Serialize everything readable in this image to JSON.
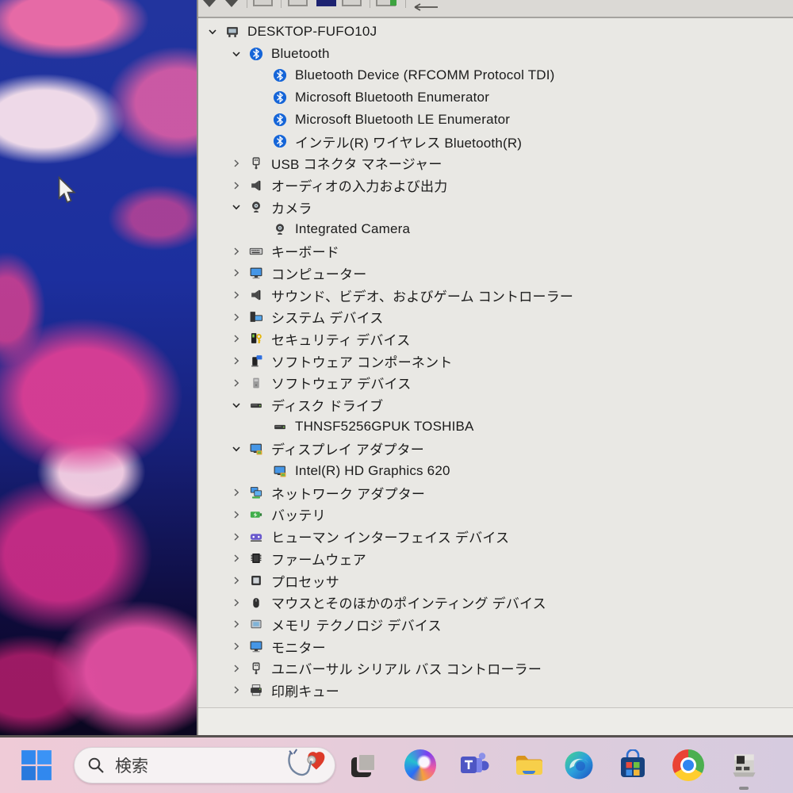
{
  "device_manager": {
    "toolbar_icons": [
      "partial-arrow-1",
      "partial-arrow-2",
      "partial-square-1",
      "partial-square-2",
      "partial-square-navy",
      "partial-square-3",
      "partial-square-green",
      "back-arrow"
    ],
    "tree": [
      {
        "label": "DESKTOP-FUFO10J",
        "icon": "computer",
        "level": 0,
        "state": "expanded"
      },
      {
        "label": "Bluetooth",
        "icon": "bluetooth",
        "level": 1,
        "state": "expanded"
      },
      {
        "label": "Bluetooth Device (RFCOMM Protocol TDI)",
        "icon": "bluetooth",
        "level": 2,
        "state": "leaf"
      },
      {
        "label": "Microsoft Bluetooth Enumerator",
        "icon": "bluetooth",
        "level": 2,
        "state": "leaf"
      },
      {
        "label": "Microsoft Bluetooth LE Enumerator",
        "icon": "bluetooth",
        "level": 2,
        "state": "leaf"
      },
      {
        "label": "インテル(R) ワイヤレス Bluetooth(R)",
        "icon": "bluetooth",
        "level": 2,
        "state": "leaf"
      },
      {
        "label": "USB コネクタ マネージャー",
        "icon": "usb",
        "level": 1,
        "state": "collapsed"
      },
      {
        "label": "オーディオの入力および出力",
        "icon": "audio",
        "level": 1,
        "state": "collapsed"
      },
      {
        "label": "カメラ",
        "icon": "camera",
        "level": 1,
        "state": "expanded"
      },
      {
        "label": "Integrated Camera",
        "icon": "camera",
        "level": 2,
        "state": "leaf"
      },
      {
        "label": "キーボード",
        "icon": "keyboard",
        "level": 1,
        "state": "collapsed"
      },
      {
        "label": "コンピューター",
        "icon": "monitor",
        "level": 1,
        "state": "collapsed"
      },
      {
        "label": "サウンド、ビデオ、およびゲーム コントローラー",
        "icon": "audio",
        "level": 1,
        "state": "collapsed"
      },
      {
        "label": "システム デバイス",
        "icon": "system",
        "level": 1,
        "state": "collapsed"
      },
      {
        "label": "セキュリティ デバイス",
        "icon": "security",
        "level": 1,
        "state": "collapsed"
      },
      {
        "label": "ソフトウェア コンポーネント",
        "icon": "software-component",
        "level": 1,
        "state": "collapsed"
      },
      {
        "label": "ソフトウェア デバイス",
        "icon": "software-device",
        "level": 1,
        "state": "collapsed"
      },
      {
        "label": "ディスク ドライブ",
        "icon": "disk",
        "level": 1,
        "state": "expanded"
      },
      {
        "label": "THNSF5256GPUK TOSHIBA",
        "icon": "disk",
        "level": 2,
        "state": "leaf"
      },
      {
        "label": "ディスプレイ アダプター",
        "icon": "display-adapter",
        "level": 1,
        "state": "expanded"
      },
      {
        "label": "Intel(R) HD Graphics 620",
        "icon": "display-adapter",
        "level": 2,
        "state": "leaf"
      },
      {
        "label": "ネットワーク アダプター",
        "icon": "network",
        "level": 1,
        "state": "collapsed"
      },
      {
        "label": "バッテリ",
        "icon": "battery",
        "level": 1,
        "state": "collapsed"
      },
      {
        "label": "ヒューマン インターフェイス デバイス",
        "icon": "hid",
        "level": 1,
        "state": "collapsed"
      },
      {
        "label": "ファームウェア",
        "icon": "firmware",
        "level": 1,
        "state": "collapsed"
      },
      {
        "label": "プロセッサ",
        "icon": "processor",
        "level": 1,
        "state": "collapsed"
      },
      {
        "label": "マウスとそのほかのポインティング デバイス",
        "icon": "mouse",
        "level": 1,
        "state": "collapsed"
      },
      {
        "label": "メモリ テクノロジ デバイス",
        "icon": "memory",
        "level": 1,
        "state": "collapsed"
      },
      {
        "label": "モニター",
        "icon": "monitor",
        "level": 1,
        "state": "collapsed"
      },
      {
        "label": "ユニバーサル シリアル バス コントローラー",
        "icon": "usb",
        "level": 1,
        "state": "collapsed"
      },
      {
        "label": "印刷キュー",
        "icon": "printer",
        "level": 1,
        "state": "collapsed"
      }
    ]
  },
  "taskbar": {
    "search_placeholder": "検索",
    "apps": [
      "start",
      "search",
      "task-view",
      "copilot",
      "teams",
      "file-explorer",
      "edge",
      "microsoft-store",
      "chrome",
      "device-manager"
    ],
    "active_app": "device-manager"
  },
  "colors": {
    "wallpaper_blue": "#1c2f9e",
    "wallpaper_pink": "#dd3e94",
    "window_bg": "#e9e8e4",
    "bluetooth_blue": "#1565d8",
    "start_blue": "#2f83ea",
    "taskbar_left": "#efcbd7",
    "taskbar_right": "#d6cbdf"
  }
}
